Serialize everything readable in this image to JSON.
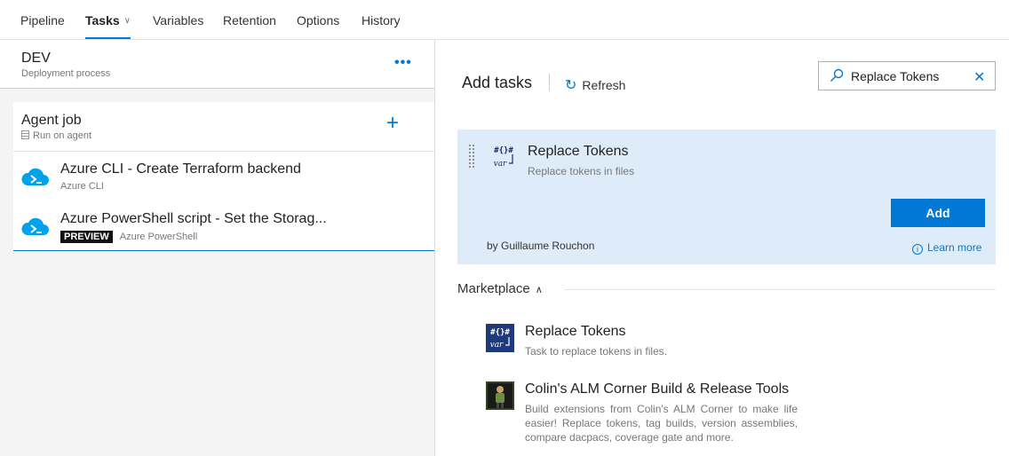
{
  "tabs": [
    {
      "label": "Pipeline"
    },
    {
      "label": "Tasks",
      "active": true
    },
    {
      "label": "Variables"
    },
    {
      "label": "Retention"
    },
    {
      "label": "Options"
    },
    {
      "label": "History"
    }
  ],
  "stage": {
    "title": "DEV",
    "subtitle": "Deployment process",
    "more_glyph": "•••"
  },
  "agent_job": {
    "title": "Agent job",
    "subtitle": "Run on agent",
    "add_glyph": "+"
  },
  "tasks": [
    {
      "title": "Azure CLI - Create Terraform backend",
      "subtitle": "Azure CLI"
    },
    {
      "title": "Azure PowerShell script - Set the Storag...",
      "badge": "PREVIEW",
      "subtitle": "Azure PowerShell"
    }
  ],
  "add_tasks": {
    "title": "Add tasks",
    "refresh_label": "Refresh",
    "search": {
      "value": "Replace Tokens",
      "placeholder": "Search"
    },
    "selected": {
      "title": "Replace Tokens",
      "description": "Replace tokens in files",
      "author": "by Guillaume Rouchon",
      "add_label": "Add",
      "learn_more": "Learn more",
      "icon_text_top": "#{}#",
      "icon_text_bottom": "var"
    },
    "marketplace": {
      "label": "Marketplace",
      "items": [
        {
          "title": "Replace Tokens",
          "description": "Task to replace tokens in files.",
          "icon_text_top": "#{}#",
          "icon_text_bottom": "var"
        },
        {
          "title": "Colin's ALM Corner Build & Release Tools",
          "description": "Build extensions from Colin's ALM Corner to make life easier! Replace tokens, tag builds, version assemblies, compare dacpacs, coverage gate and more."
        }
      ]
    }
  },
  "colors": {
    "accent": "#0078d4",
    "selected_bg": "#deecf9",
    "azure_cloud": "#00a2ed"
  }
}
